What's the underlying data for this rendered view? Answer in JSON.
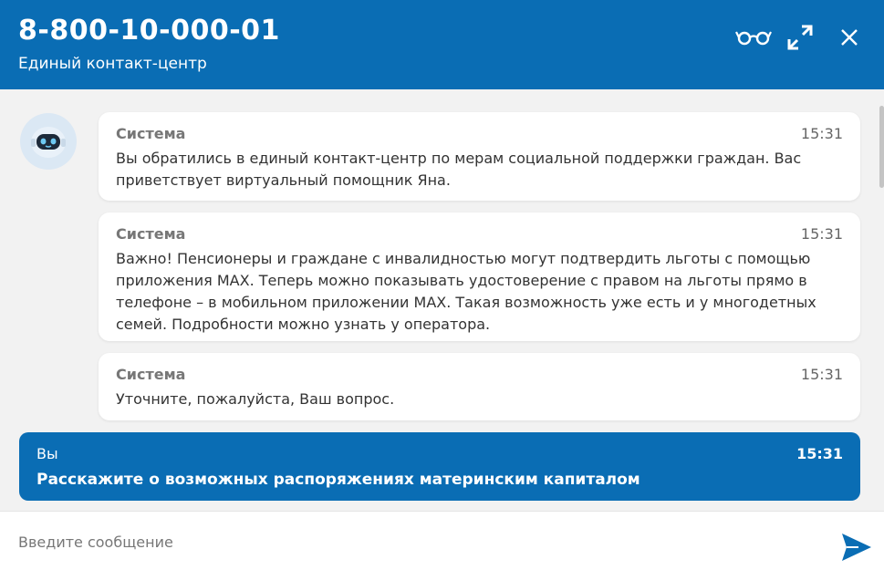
{
  "header": {
    "phone": "8-800-10-000-01",
    "subtitle": "Единый контакт-центр",
    "icons": [
      "glasses-icon",
      "expand-icon",
      "close-icon"
    ],
    "color": "#0a6db4"
  },
  "messages": [
    {
      "sender": "Система",
      "time": "15:31",
      "text": "Вы обратились в единый контакт-центр по мерам социальной поддержки граждан. Вас приветствует виртуальный помощник Яна."
    },
    {
      "sender": "Система",
      "time": "15:31",
      "text": "Важно! Пенсионеры и граждане с инвалидностью могут подтвердить льготы с помощью приложения MAX. Теперь можно показывать удостоверение с правом на льготы прямо в телефоне – в мобильном приложении MAX. Такая возможность уже есть и у многодетных семей. Подробности можно узнать у оператора."
    },
    {
      "sender": "Система",
      "time": "15:31",
      "text": "Уточните, пожалуйста, Ваш вопрос."
    }
  ],
  "user_message": {
    "sender": "Вы",
    "time": "15:31",
    "text": "Расскажите о возможных распоряжениях материнским капиталом"
  },
  "composer": {
    "placeholder": "Введите сообщение",
    "send_icon": "send-icon"
  }
}
